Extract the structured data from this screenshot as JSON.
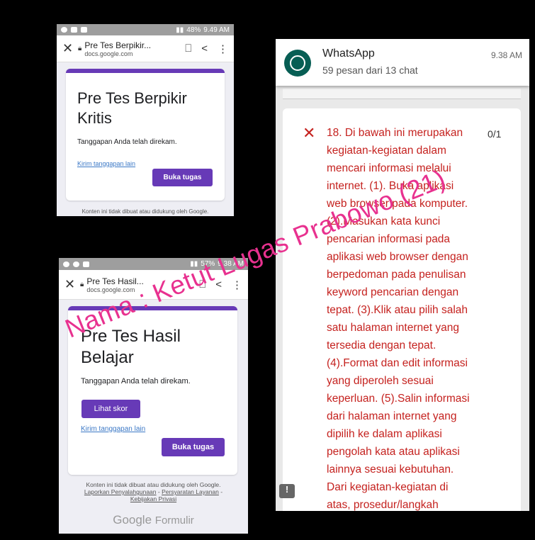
{
  "screen1": {
    "status": {
      "battery": "48%",
      "time": "9.49 AM"
    },
    "urlbar": {
      "title": "Pre Tes Berpikir...",
      "domain": "docs.google.com"
    },
    "form_title": "Pre Tes Berpikir Kritis",
    "recorded": "Tanggapan Anda telah direkam.",
    "resubmit_link": "Kirim tanggapan lain",
    "task_button": "Buka tugas",
    "footer": "Konten ini tidak dibuat atau didukung oleh Google."
  },
  "screen2": {
    "status": {
      "battery": "57%",
      "time": "9.38 AM"
    },
    "urlbar": {
      "title": "Pre Tes Hasil...",
      "domain": "docs.google.com"
    },
    "form_title": "Pre Tes Hasil Belajar",
    "recorded": "Tanggapan Anda telah direkam.",
    "score_button": "Lihat skor",
    "resubmit_link": "Kirim tanggapan lain",
    "task_button": "Buka tugas",
    "footer_line1": "Konten ini tidak dibuat atau didukung oleh Google.",
    "footer_links": {
      "report": "Laporkan Penyalahgunaan",
      "sep1": " - ",
      "terms": "Persyaratan Layanan",
      "sep2": " -",
      "privacy": "Kebijakan Privasi"
    },
    "brand": {
      "google": "Google",
      "forms": "Formulir"
    }
  },
  "screen3": {
    "notification": {
      "app": "WhatsApp",
      "subtitle": "59 pesan dari 13 chat",
      "time": "9.38 AM"
    },
    "question": {
      "mark": "✕",
      "score": "0/1",
      "lines": [
        "18. Di bawah ini merupakan",
        "kegiatan-kegiatan dalam",
        "mencari informasi melalui",
        "internet. (1). Buka aplikasi",
        "web browser pada komputer.",
        "(2).Masukan kata kunci",
        "pencarian informasi pada",
        "aplikasi web browser dengan",
        "berpedoman pada penulisan",
        "keyword pencarian dengan",
        "tepat. (3).Klik atau pilih salah",
        "satu halaman internet yang",
        "tersedia dengan tepat.",
        "(4).Format dan edit informasi",
        "yang diperoleh sesuai",
        "keperluan. (5).Salin informasi",
        "dari halaman internet yang",
        "dipilih ke dalam aplikasi",
        "pengolah kata atau aplikasi",
        "lainnya sesuai kebutuhan.",
        "Dari kegiatan-kegiatan di",
        "atas, prosedur/langkah"
      ]
    },
    "feedback_icon": "!"
  },
  "watermark": "Nama : Ketut Lugas Prabowo (21)",
  "colors": {
    "accent": "#673ab7",
    "wrong": "#c5221f",
    "whatsapp": "#075e54",
    "watermark": "#e8318f"
  }
}
